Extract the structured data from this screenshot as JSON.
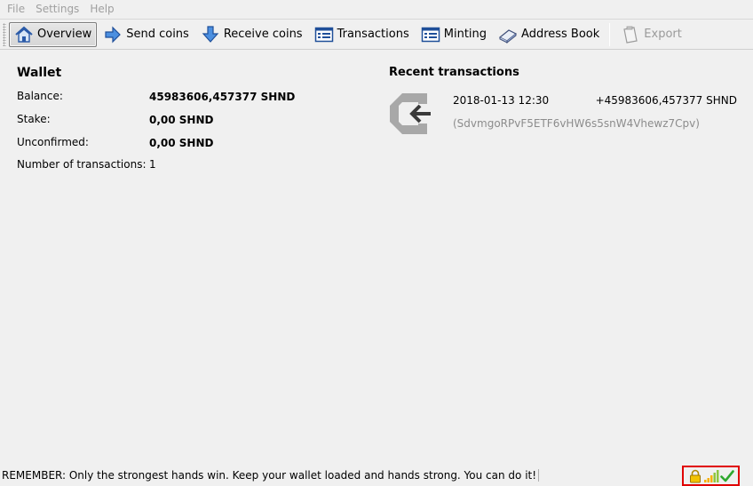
{
  "menu": {
    "file": "File",
    "settings": "Settings",
    "help": "Help"
  },
  "toolbar": {
    "overview": "Overview",
    "send_coins": "Send coins",
    "receive_coins": "Receive coins",
    "transactions": "Transactions",
    "minting": "Minting",
    "address_book": "Address Book",
    "export": "Export"
  },
  "wallet": {
    "title": "Wallet",
    "balance_label": "Balance:",
    "balance_value": "45983606,457377 SHND",
    "stake_label": "Stake:",
    "stake_value": "0,00 SHND",
    "unconfirmed_label": "Unconfirmed:",
    "unconfirmed_value": "0,00 SHND",
    "num_tx_label": "Number of transactions:",
    "num_tx_value": "1"
  },
  "recent": {
    "title": "Recent transactions",
    "items": [
      {
        "date": "2018-01-13 12:30",
        "amount": "+45983606,457377 SHND",
        "address": "(SdvmgoRPvF5ETF6vHW6s5snW4Vhewz7Cpv)"
      }
    ]
  },
  "status": {
    "message": "REMEMBER: Only the strongest hands win. Keep your wallet loaded and hands strong. You can do it!"
  },
  "colors": {
    "highlight_border": "#e00000",
    "address_text": "#8c8c8c"
  }
}
